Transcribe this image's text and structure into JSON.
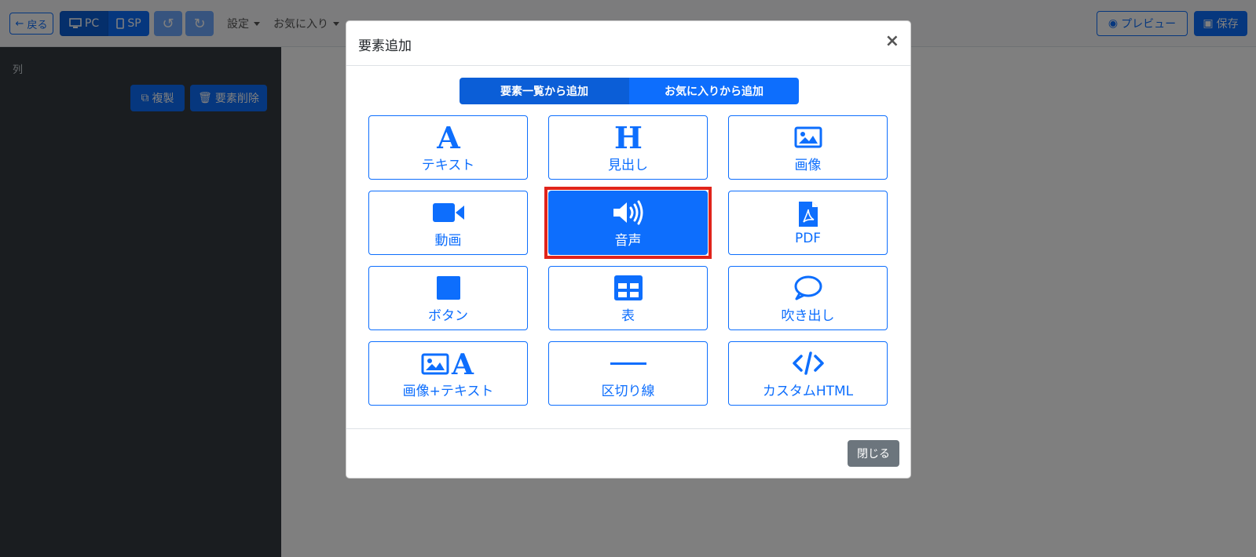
{
  "toolbar": {
    "back_label": "戻る",
    "pc_label": "PC",
    "sp_label": "SP",
    "settings_label": "設定",
    "favorites_label": "お気に入り",
    "preview_label": "プレビュー",
    "save_label": "保存"
  },
  "sidebar": {
    "section_label": "列",
    "duplicate_label": "複製",
    "delete_label": "要素削除"
  },
  "modal": {
    "title": "要素追加",
    "close_symbol": "×",
    "tabs": [
      {
        "label": "要素一覧から追加",
        "active": true
      },
      {
        "label": "お気に入りから追加",
        "active": false
      }
    ],
    "elements": [
      {
        "label": "テキスト",
        "icon": "text-a-icon"
      },
      {
        "label": "見出し",
        "icon": "heading-h-icon"
      },
      {
        "label": "画像",
        "icon": "image-icon"
      },
      {
        "label": "動画",
        "icon": "video-icon"
      },
      {
        "label": "音声",
        "icon": "speaker-icon",
        "selected": true
      },
      {
        "label": "PDF",
        "icon": "pdf-file-icon"
      },
      {
        "label": "ボタン",
        "icon": "button-square-icon"
      },
      {
        "label": "表",
        "icon": "table-icon"
      },
      {
        "label": "吹き出し",
        "icon": "speech-bubble-icon"
      },
      {
        "label": "画像+テキスト",
        "icon": "image-text-icon"
      },
      {
        "label": "区切り線",
        "icon": "divider-line-icon"
      },
      {
        "label": "カスタムHTML",
        "icon": "code-icon"
      }
    ],
    "footer_close_label": "閉じる"
  },
  "colors": {
    "primary": "#0d6efd",
    "primary_dark": "#0b5ed7",
    "sidebar_bg": "#343a40",
    "highlight": "#e0241b",
    "secondary": "#6c757d"
  }
}
